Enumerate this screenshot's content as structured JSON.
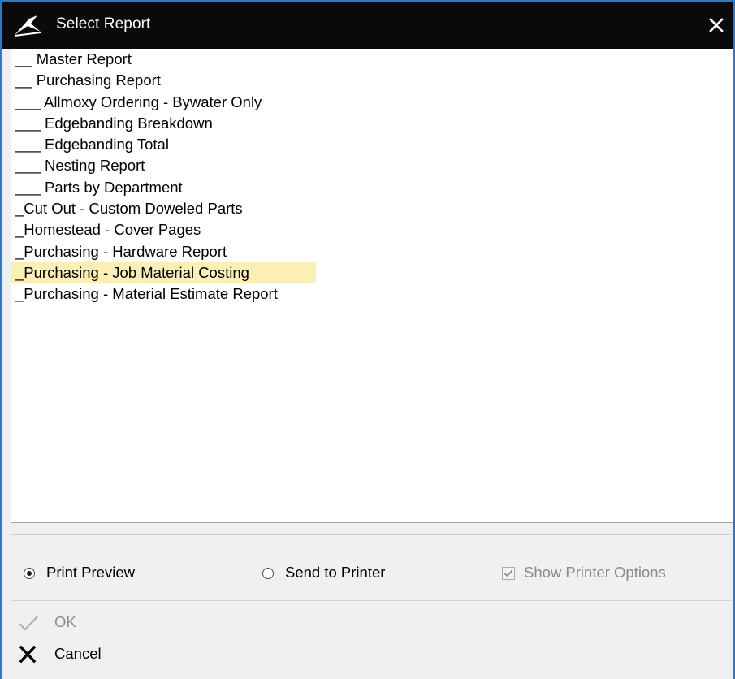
{
  "window": {
    "title": "Select Report",
    "close_icon": "close-icon",
    "app_icon": "app-logo-icon"
  },
  "report_list": {
    "items": [
      {
        "label": "__ Master Report",
        "selected": false
      },
      {
        "label": "__ Purchasing Report",
        "selected": false
      },
      {
        "label": "___ Allmoxy Ordering - Bywater Only",
        "selected": false
      },
      {
        "label": "___ Edgebanding Breakdown",
        "selected": false
      },
      {
        "label": "___ Edgebanding Total",
        "selected": false
      },
      {
        "label": "___ Nesting Report",
        "selected": false
      },
      {
        "label": "___ Parts by Department",
        "selected": false
      },
      {
        "label": "_Cut Out - Custom Doweled Parts",
        "selected": false
      },
      {
        "label": "_Homestead - Cover Pages",
        "selected": false
      },
      {
        "label": "_Purchasing - Hardware Report",
        "selected": false
      },
      {
        "label": "_Purchasing - Job Material Costing",
        "selected": true
      },
      {
        "label": "_Purchasing - Material Estimate Report",
        "selected": false
      }
    ],
    "selected_color": "#fbefb3"
  },
  "output_options": {
    "print_preview": {
      "label": "Print Preview",
      "checked": true
    },
    "send_to_printer": {
      "label": "Send to Printer",
      "checked": false
    },
    "show_printer_options": {
      "label": "Show Printer Options",
      "checked": true,
      "disabled": true
    }
  },
  "actions": {
    "ok": {
      "label": "OK",
      "icon": "checkmark-icon",
      "disabled": true
    },
    "cancel": {
      "label": "Cancel",
      "icon": "x-icon",
      "disabled": false
    }
  },
  "colors": {
    "titlebar": "#0a0a0a",
    "window_border": "#2b78d0",
    "dialog_background": "#f0f0f0"
  }
}
